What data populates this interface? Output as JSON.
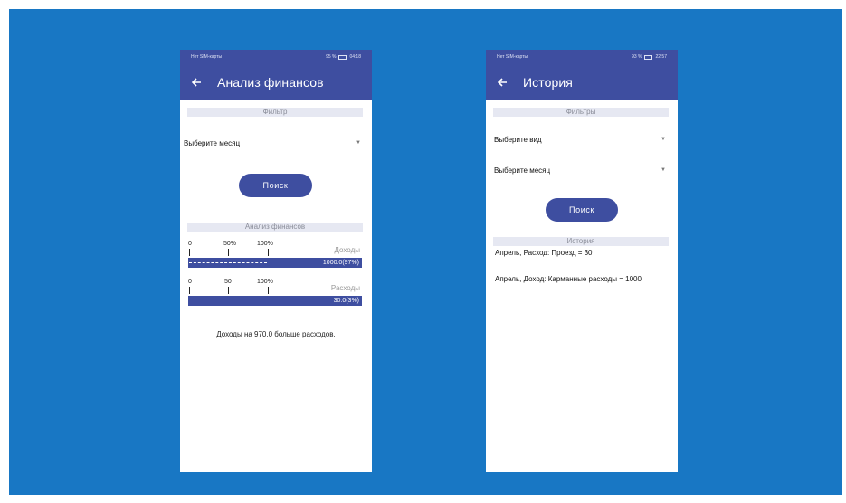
{
  "left_screen": {
    "status": {
      "carrier": "Нет SIM-карты",
      "battery": "95 %",
      "time": "04:18"
    },
    "toolbar": {
      "title": "Анализ финансов"
    },
    "filter_header": "Фильтр",
    "month_select": {
      "value": "Выберите месяц"
    },
    "search_button": "Поиск",
    "analysis_header": "Анализ финансов",
    "income_scale": {
      "ticks": [
        "0",
        "50%",
        "100%"
      ],
      "name": "Доходы"
    },
    "income_bar": {
      "label": "1000.0(97%)",
      "fill": 0.97
    },
    "expense_scale": {
      "ticks": [
        "0",
        "50",
        "100%"
      ],
      "name": "Расходы"
    },
    "expense_bar": {
      "label": "30.0(3%)",
      "fill": 0.03
    },
    "summary": "Доходы на 970.0 больше расходов."
  },
  "right_screen": {
    "status": {
      "carrier": "Нет SIM-карты",
      "battery": "93 %",
      "time": "22:57"
    },
    "toolbar": {
      "title": "История"
    },
    "filters_header": "Фильтры",
    "type_select": {
      "value": "Выберите вид"
    },
    "month_select": {
      "value": "Выберите месяц"
    },
    "search_button": "Поиск",
    "history_header": "История",
    "history_items": [
      "Апрель, Расход: Проезд = 30",
      "Апрель, Доход: Карманные расходы = 1000"
    ]
  },
  "colors": {
    "accent": "#3e4ea0",
    "background": "#1877c4",
    "section_bg": "#e6e8f2"
  },
  "icons": {
    "back": "arrow-left-icon",
    "dropdown": "caret-down-icon"
  }
}
